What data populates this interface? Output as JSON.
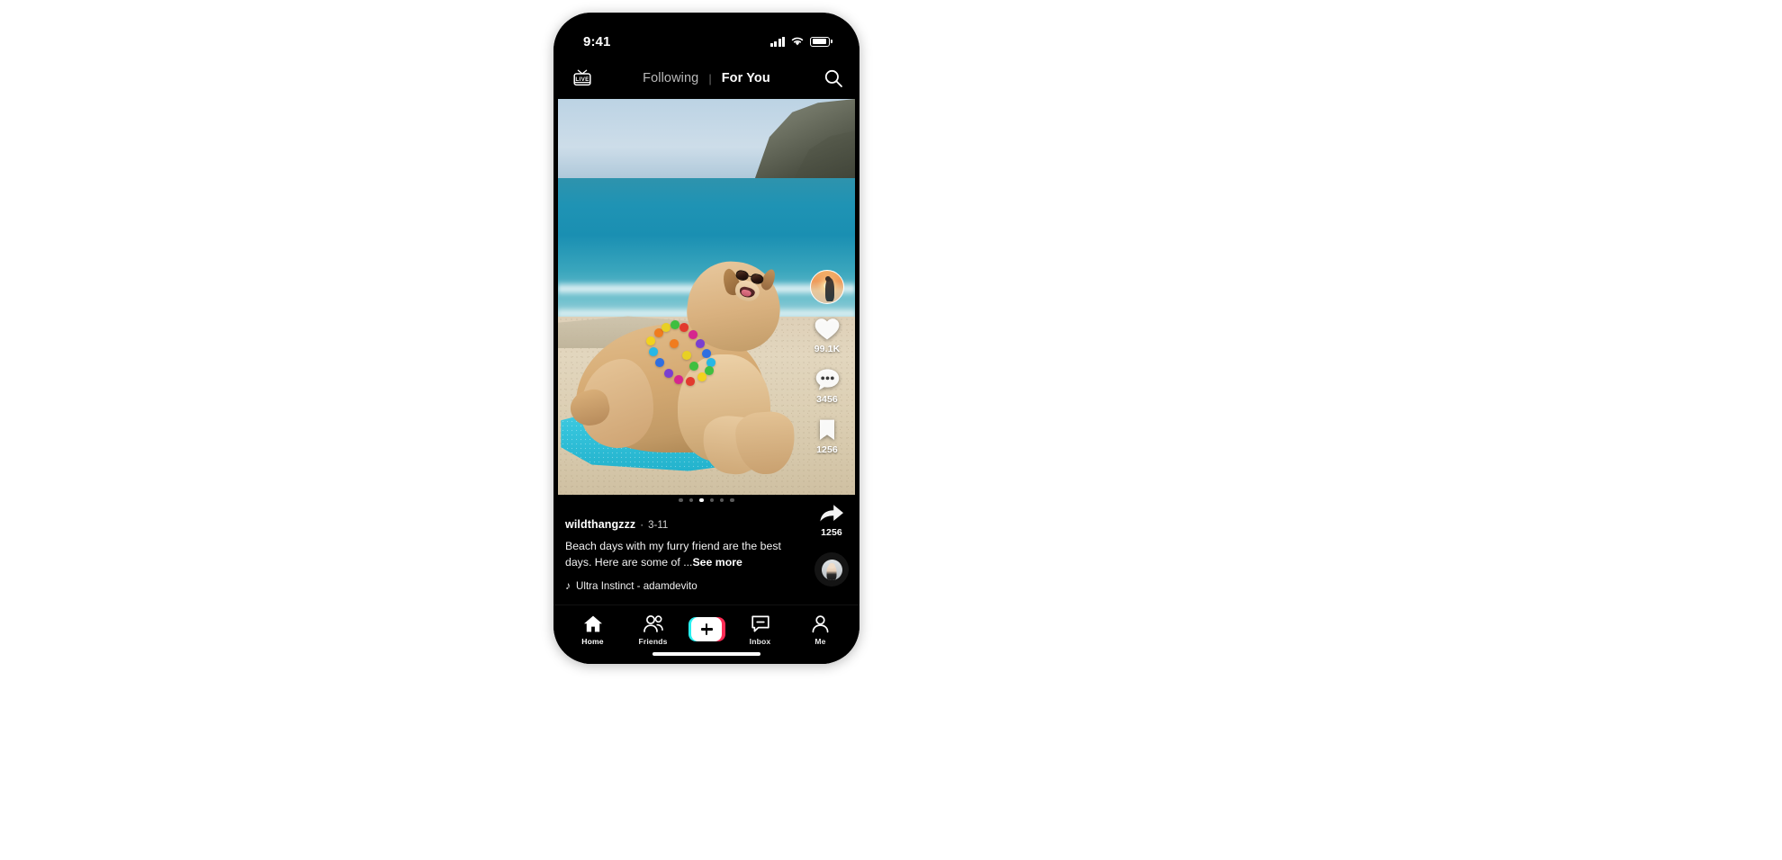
{
  "status_bar": {
    "time": "9:41",
    "cellular_icon": "cellular-bars-icon",
    "wifi_icon": "wifi-icon",
    "battery_icon": "battery-icon"
  },
  "top_nav": {
    "live_label": "LIVE",
    "live_icon": "live-tv-icon",
    "tabs": [
      {
        "label": "Following",
        "active": false
      },
      {
        "label": "For You",
        "active": true
      }
    ],
    "separator": "|",
    "search_icon": "search-icon"
  },
  "video": {
    "carousel": {
      "total": 6,
      "active_index": 2
    }
  },
  "action_rail": {
    "avatar": {
      "name": "creator-avatar",
      "alt": "sunset-silhouette"
    },
    "like": {
      "icon": "heart-icon",
      "count": "99.1K"
    },
    "comment": {
      "icon": "comment-bubble-icon",
      "count": "3456"
    },
    "bookmark": {
      "icon": "bookmark-icon",
      "count": "1256"
    },
    "share": {
      "icon": "share-arrow-icon",
      "count": "1256"
    },
    "music_disc": {
      "icon": "spinning-music-disc"
    }
  },
  "caption": {
    "username": "wildthangzzz",
    "separator": "·",
    "date": "3-11",
    "text": "Beach days with my furry friend are the best days. Here are some of ...",
    "see_more": "See more",
    "music_note_icon": "music-note-icon",
    "music": "Ultra Instinct - adamdevito"
  },
  "tab_bar": {
    "items": [
      {
        "label": "Home",
        "icon": "home-icon",
        "active": true
      },
      {
        "label": "Friends",
        "icon": "friends-icon",
        "active": false
      },
      {
        "label": "Inbox",
        "icon": "inbox-icon",
        "active": false
      },
      {
        "label": "Me",
        "icon": "profile-icon",
        "active": false
      }
    ],
    "create_button": {
      "icon": "plus-icon",
      "label": ""
    }
  },
  "colors": {
    "accent_pink": "#fe2c55",
    "accent_cyan": "#27efef",
    "background": "#000000",
    "text_primary": "#ffffff",
    "text_muted": "#b9b9b9"
  }
}
